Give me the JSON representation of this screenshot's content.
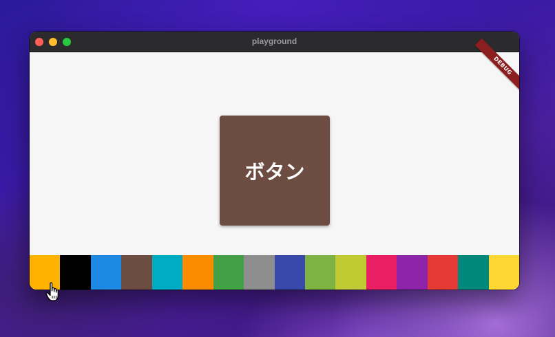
{
  "window": {
    "title": "playground",
    "debug_banner": "DEBUG"
  },
  "main": {
    "button_label": "ボタン",
    "button_color": "#6d4c41"
  },
  "palette": [
    "#ffb300",
    "#000000",
    "#1e88e5",
    "#6d4c41",
    "#00acc1",
    "#fb8c00",
    "#43a047",
    "#8e8e8e",
    "#3949ab",
    "#7cb342",
    "#c0ca33",
    "#e91e63",
    "#8e24aa",
    "#e53935",
    "#00897b",
    "#fdd835"
  ],
  "icons": {
    "cursor": "hand-pointer-icon"
  }
}
